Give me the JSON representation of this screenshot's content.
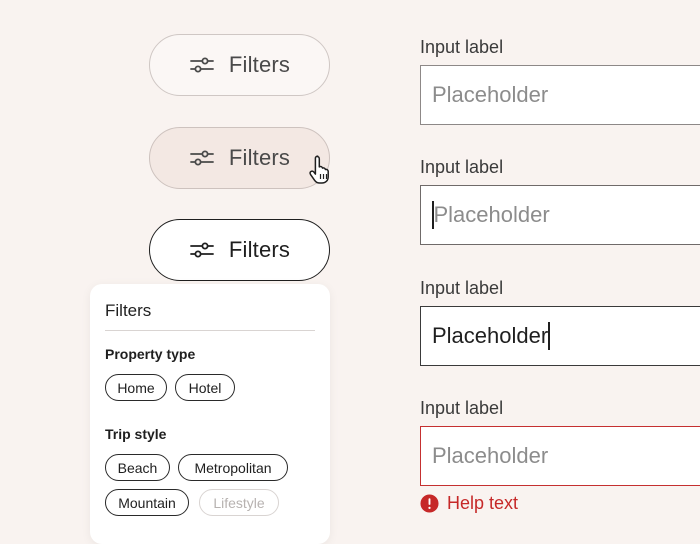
{
  "filters_buttons": [
    {
      "state": "default",
      "label": "Filters",
      "icon": "sliders-icon"
    },
    {
      "state": "hover",
      "label": "Filters",
      "icon": "sliders-icon"
    },
    {
      "state": "active",
      "label": "Filters",
      "icon": "sliders-icon"
    }
  ],
  "filters_panel": {
    "title": "Filters",
    "sections": [
      {
        "label": "Property type",
        "chips": [
          {
            "label": "Home"
          },
          {
            "label": "Hotel"
          }
        ]
      },
      {
        "label": "Trip style",
        "chips": [
          {
            "label": "Beach"
          },
          {
            "label": "Metropolitan"
          },
          {
            "label": "Mountain"
          },
          {
            "label": "Lifestyle",
            "disabled": true
          }
        ]
      }
    ]
  },
  "inputs": [
    {
      "state": "default",
      "label": "Input label",
      "placeholder": "Placeholder"
    },
    {
      "state": "focused",
      "label": "Input label",
      "placeholder": "Placeholder"
    },
    {
      "state": "filled",
      "label": "Input label",
      "value": "Placeholder"
    },
    {
      "state": "error",
      "label": "Input label",
      "placeholder": "Placeholder",
      "help_text": "Help text"
    }
  ],
  "colors": {
    "background": "#f9f3f0",
    "error": "#c62828",
    "border": "#8d8887",
    "active_border": "#1f1f1f"
  },
  "cursor_icon": "hand-pointer-icon"
}
